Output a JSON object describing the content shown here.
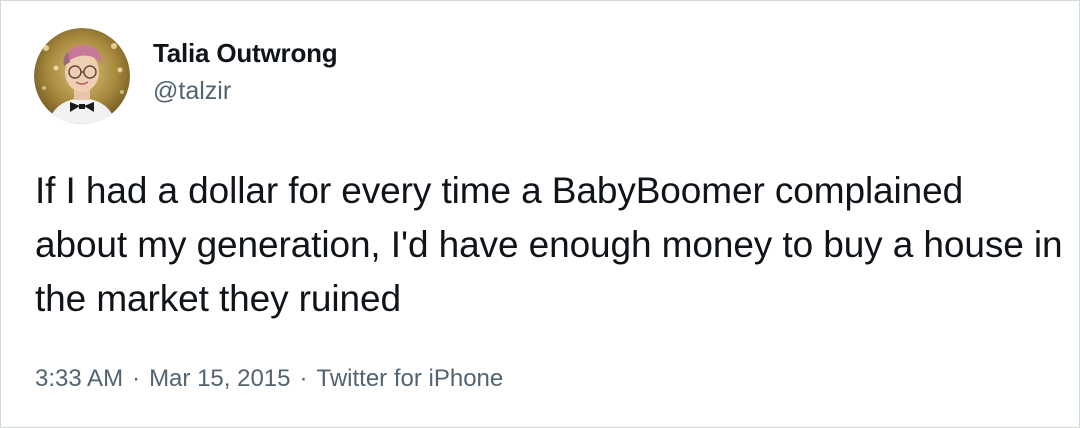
{
  "user": {
    "display_name": "Talia Outwrong",
    "handle": "@talzir",
    "avatar_icon": "profile-photo"
  },
  "tweet": {
    "text": "If I had a dollar for every time a BabyBoomer complained about my generation, I'd have enough money to buy a house in the market they ruined"
  },
  "meta": {
    "time": "3:33 AM",
    "separator": "·",
    "date": "Mar 15, 2015",
    "source": "Twitter for iPhone"
  },
  "colors": {
    "text_primary": "#0f1419",
    "text_secondary": "#536471",
    "border": "#cfd9de",
    "background": "#ffffff"
  }
}
